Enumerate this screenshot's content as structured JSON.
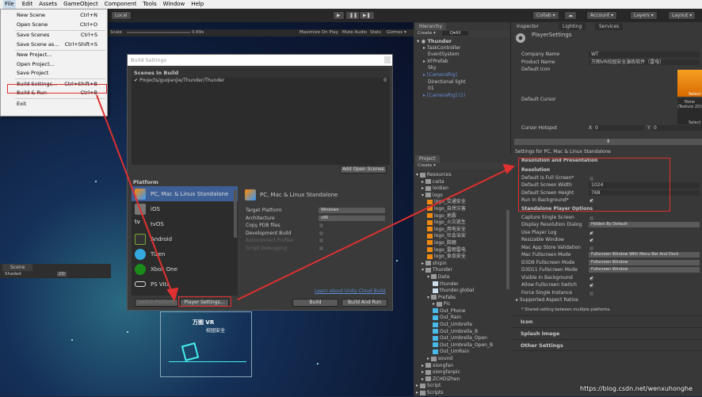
{
  "menubar": {
    "items": [
      "File",
      "Edit",
      "Assets",
      "GameObject",
      "Component",
      "Tools",
      "Window",
      "Help"
    ]
  },
  "toolbar": {
    "local": "Local",
    "play": "▶",
    "pause": "❚❚",
    "step": "▶❚",
    "collab": "Collab ▾",
    "account": "Account ▾",
    "layers": "Layers ▾",
    "layout": "Layout ▾"
  },
  "game_bar": {
    "scale_label": "Scale",
    "scale_value": "0.69x",
    "maximize": "Maximize On Play",
    "mute": "Mute Audio",
    "stats": "Stats",
    "gizmos": "Gizmos ▾"
  },
  "scene_tab": {
    "label": "Scene",
    "shaded": "Shaded",
    "mode_2d": "2D"
  },
  "scene_logo": {
    "line1": "万图 VR",
    "line2": "校园安全"
  },
  "file_menu": {
    "items": [
      {
        "label": "New Scene",
        "shortcut": "Ctrl+N"
      },
      {
        "label": "Open Scene",
        "shortcut": "Ctrl+O"
      },
      {
        "label": "Save Scenes",
        "shortcut": "Ctrl+S"
      },
      {
        "label": "Save Scene as...",
        "shortcut": "Ctrl+Shift+S"
      },
      {
        "label": "New Project...",
        "shortcut": ""
      },
      {
        "label": "Open Project...",
        "shortcut": ""
      },
      {
        "label": "Save Project",
        "shortcut": ""
      },
      {
        "label": "Build Settings...",
        "shortcut": "Ctrl+Shift+B"
      },
      {
        "label": "Build & Run",
        "shortcut": "Ctrl+B"
      },
      {
        "label": "Exit",
        "shortcut": ""
      }
    ]
  },
  "build_settings": {
    "title": "Build Settings",
    "scenes_header": "Scenes In Build",
    "scene": {
      "path": "Projects/guqianjie/Thunder/Thunder",
      "index": "0",
      "checked": true
    },
    "add_open_scenes": "Add Open Scenes",
    "platform_header": "Platform",
    "platforms": [
      {
        "name": "PC, Mac & Linux Standalone",
        "selected": true
      },
      {
        "name": "iOS"
      },
      {
        "name": "tvOS"
      },
      {
        "name": "Android"
      },
      {
        "name": "Tizen"
      },
      {
        "name": "Xbox One"
      },
      {
        "name": "PS Vita"
      }
    ],
    "selected_title": "PC, Mac & Linux Standalone",
    "options": [
      {
        "label": "Target Platform",
        "value": "Windows"
      },
      {
        "label": "Architecture",
        "value": "x86"
      },
      {
        "label": "Copy PDB files",
        "checked": false
      },
      {
        "label": "Development Build",
        "checked": false
      },
      {
        "label": "Autoconnect Profiler",
        "checked": false
      },
      {
        "label": "Script Debugging",
        "checked": false
      }
    ],
    "cloud_link": "Learn about Unity Cloud Build",
    "switch_platform": "Switch Platform",
    "player_settings": "Player Settings...",
    "build": "Build",
    "build_and_run": "Build And Run"
  },
  "hierarchy": {
    "tab": "Hierarchy",
    "create": "Create ▾",
    "search": "Q▾All",
    "root": "Thunder",
    "items": [
      {
        "label": "TaskController",
        "arrow": true
      },
      {
        "label": "EventSystem"
      },
      {
        "label": "XFPrefab",
        "arrow": true
      },
      {
        "label": "Sky"
      },
      {
        "label": "[CameraRig]",
        "arrow": true,
        "prefab": true
      },
      {
        "label": "Directional light"
      },
      {
        "label": "01"
      },
      {
        "label": "[CameraRig] (1)",
        "arrow": true,
        "prefab": true
      }
    ]
  },
  "project": {
    "tab": "Project",
    "create": "Create ▾",
    "items": [
      {
        "label": "Resources",
        "depth": 0,
        "type": "folder",
        "open": true
      },
      {
        "label": "caita",
        "depth": 1,
        "type": "folder"
      },
      {
        "label": "leidian",
        "depth": 1,
        "type": "folder"
      },
      {
        "label": "logo",
        "depth": 1,
        "type": "folder",
        "open": true
      },
      {
        "label": "logo_交通安全",
        "depth": 2,
        "type": "image"
      },
      {
        "label": "logo_自然灾害",
        "depth": 2,
        "type": "image"
      },
      {
        "label": "logo_地震",
        "depth": 2,
        "type": "image"
      },
      {
        "label": "logo_火灾逃生",
        "depth": 2,
        "type": "image"
      },
      {
        "label": "logo_用电安全",
        "depth": 2,
        "type": "image"
      },
      {
        "label": "logo_社会治安",
        "depth": 2,
        "type": "image"
      },
      {
        "label": "logo_踩踏",
        "depth": 2,
        "type": "image"
      },
      {
        "label": "logo_雷雨雷电",
        "depth": 2,
        "type": "image"
      },
      {
        "label": "logo_食品安全",
        "depth": 2,
        "type": "image"
      },
      {
        "label": "shipin",
        "depth": 1,
        "type": "folder"
      },
      {
        "label": "Thunder",
        "depth": 1,
        "type": "folder",
        "open": true
      },
      {
        "label": "Data",
        "depth": 2,
        "type": "folder",
        "open": true
      },
      {
        "label": "thunder",
        "depth": 3,
        "type": "file"
      },
      {
        "label": "thunder.global",
        "depth": 3,
        "type": "file"
      },
      {
        "label": "Prefabs",
        "depth": 2,
        "type": "folder",
        "open": true
      },
      {
        "label": "Pic",
        "depth": 3,
        "type": "folder"
      },
      {
        "label": "Out_Phone",
        "depth": 3,
        "type": "prefab"
      },
      {
        "label": "Out_Rain",
        "depth": 3,
        "type": "prefab"
      },
      {
        "label": "Out_Umbrella",
        "depth": 3,
        "type": "prefab"
      },
      {
        "label": "Out_Umbrella_B",
        "depth": 3,
        "type": "prefab"
      },
      {
        "label": "Out_Umbrella_Open",
        "depth": 3,
        "type": "prefab"
      },
      {
        "label": "Out_Umbrella_Open_B",
        "depth": 3,
        "type": "prefab"
      },
      {
        "label": "Out_UmRain",
        "depth": 3,
        "type": "prefab"
      },
      {
        "label": "sound",
        "depth": 2,
        "type": "folder"
      },
      {
        "label": "xiongfan",
        "depth": 1,
        "type": "folder"
      },
      {
        "label": "xiongfanpic",
        "depth": 1,
        "type": "folder"
      },
      {
        "label": "ZCHDiZhen",
        "depth": 1,
        "type": "folder"
      },
      {
        "label": "Script",
        "depth": 0,
        "type": "folder"
      },
      {
        "label": "Scripts",
        "depth": 0,
        "type": "folder"
      }
    ]
  },
  "inspector": {
    "tabs": [
      "Inspector",
      "Lighting",
      "Services"
    ],
    "title": "PlayerSettings",
    "company_label": "Company Name",
    "company": "WT",
    "product_label": "Product Name",
    "product": "万图VR校园安全演练软件（雷电）",
    "icon_label": "Default Icon",
    "cursor_label": "Default Cursor",
    "select": "Select",
    "none_texture": "None (Texture 2D)",
    "hotspot_label": "Cursor Hotspot",
    "hotspot_x_label": "X",
    "hotspot_x": "0",
    "hotspot_y_label": "Y",
    "hotspot_y": "0",
    "settings_for": "Settings for PC, Mac & Linux Standalone",
    "res_pres": "Resolution and Presentation",
    "resolution": "Resolution",
    "res_rows": [
      {
        "label": "Default Is Full Screen*",
        "checked": false
      },
      {
        "label": "Default Screen Width",
        "value": "1024"
      },
      {
        "label": "Default Screen Height",
        "value": "768"
      },
      {
        "label": "Run In Background*",
        "checked": true
      }
    ],
    "standalone": "Standalone Player Options",
    "sa_rows": [
      {
        "label": "Capture Single Screen",
        "checked": false
      },
      {
        "label": "Display Resolution Dialog",
        "select": "Hidden By Default"
      },
      {
        "label": "Use Player Log",
        "checked": true
      },
      {
        "label": "Resizable Window",
        "checked": true
      },
      {
        "label": "Mac App Store Validation",
        "checked": false
      },
      {
        "label": "Mac Fullscreen Mode",
        "select": "Fullscreen Window With Menu Bar And Dock"
      },
      {
        "label": "D3D9 Fullscreen Mode",
        "select": "Fullscreen Window"
      },
      {
        "label": "D3D11 Fullscreen Mode",
        "select": "Fullscreen Window"
      },
      {
        "label": "Visible In Background",
        "checked": true
      },
      {
        "label": "Allow Fullscreen Switch",
        "checked": true
      },
      {
        "label": "Force Single Instance",
        "checked": false
      }
    ],
    "aspect": "Supported Aspect Ratios",
    "shared_note": "* Shared setting between multiple platforms.",
    "sections": [
      "Icon",
      "Splash Image",
      "Other Settings"
    ]
  },
  "watermark": "https://blog.csdn.net/wenxuhonghe",
  "colors": {
    "highlight": "#e03030",
    "selected_platform": "#3e5f96",
    "icon_orange": "#f08a10"
  }
}
